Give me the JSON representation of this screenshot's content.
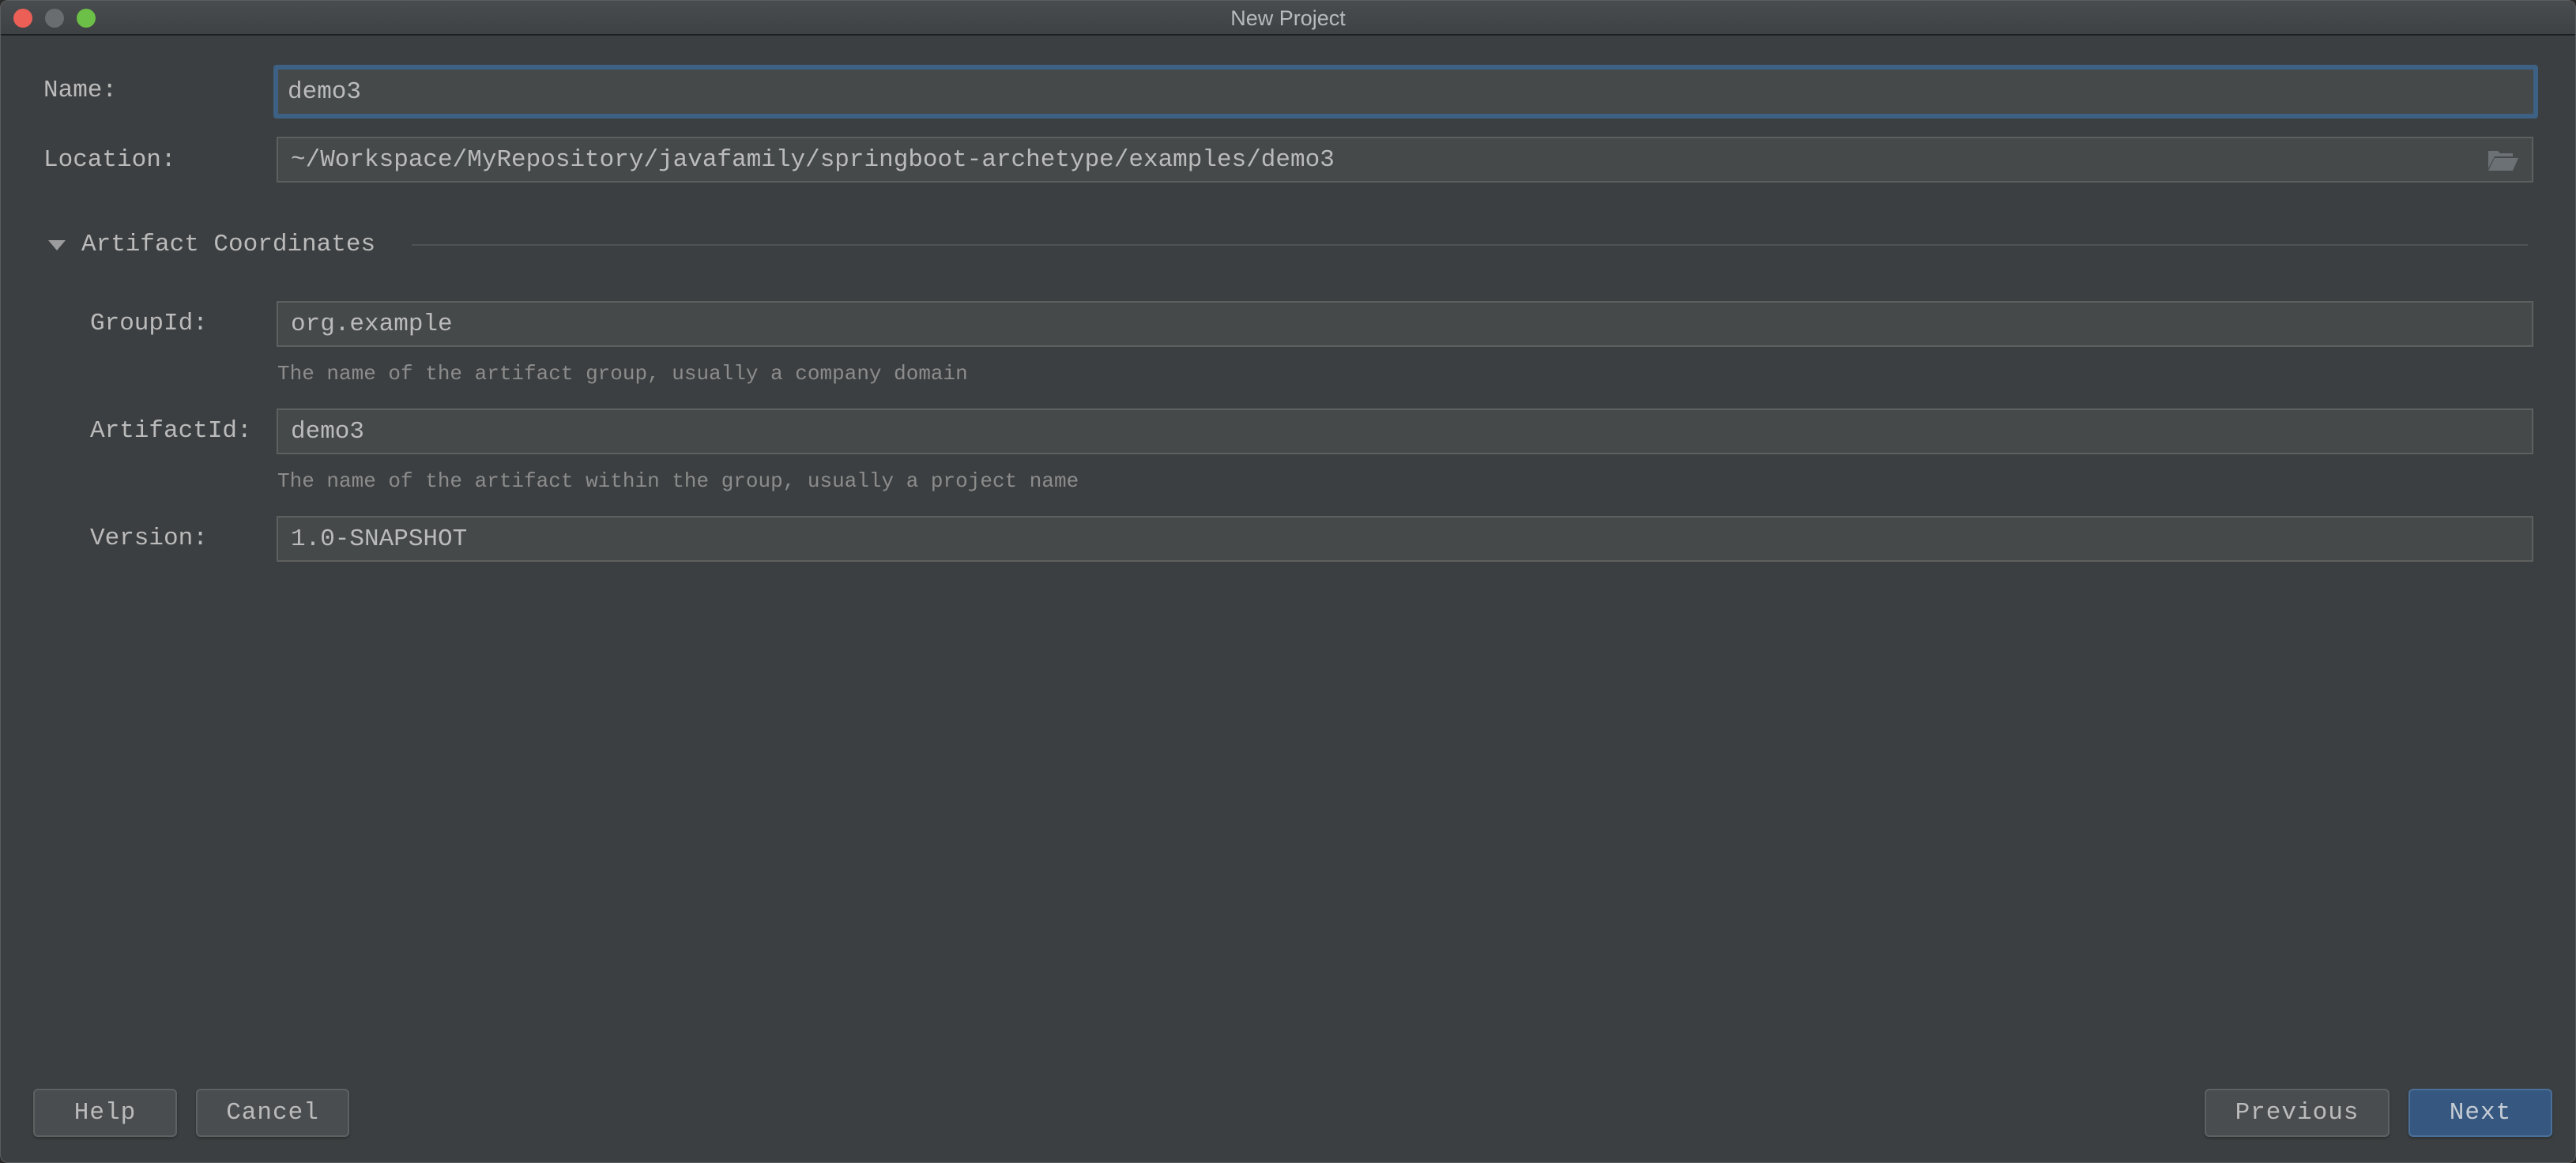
{
  "window": {
    "title": "New Project",
    "controls": [
      "close",
      "minimize",
      "maximize"
    ]
  },
  "form": {
    "name": {
      "label": "Name:",
      "value": "demo3",
      "focused": true
    },
    "location": {
      "label": "Location:",
      "value": "~/Workspace/MyRepository/javafamily/springboot-archetype/examples/demo3",
      "browse_icon": "folder-open-icon"
    }
  },
  "artifact_section": {
    "title": "Artifact Coordinates",
    "expanded": true,
    "group_id": {
      "label": "GroupId:",
      "value": "org.example",
      "hint": "The name of the artifact group, usually a company domain"
    },
    "artifact_id": {
      "label": "ArtifactId:",
      "value": "demo3",
      "hint": "The name of the artifact within the group, usually a project name"
    },
    "version": {
      "label": "Version:",
      "value": "1.0-SNAPSHOT"
    }
  },
  "buttons": {
    "help": "Help",
    "cancel": "Cancel",
    "previous": "Previous",
    "next": "Next"
  },
  "colors": {
    "background": "#3c3f41",
    "field_background": "#45494a",
    "focus_ring": "#3d6185",
    "primary_button": "#365880",
    "close": "#ec5f56",
    "minimize": "#6a6d70",
    "maximize": "#6cbf47"
  }
}
